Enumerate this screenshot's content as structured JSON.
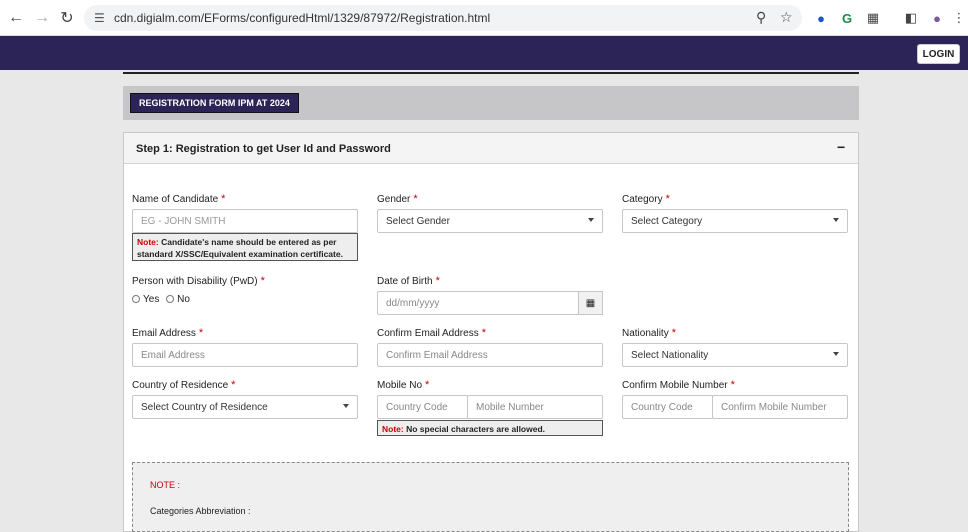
{
  "browser": {
    "url": "cdn.digialm.com/EForms/configuredHtml/1329/87972/Registration.html"
  },
  "header": {
    "login_label": "LOGIN"
  },
  "form": {
    "title": "REGISTRATION FORM IPM AT 2024",
    "step_title": "Step 1: Registration to get User Id and Password",
    "collapse_symbol": "−",
    "required_mark": "*",
    "note_prefix": "Note:",
    "name": {
      "label": "Name of Candidate",
      "placeholder": "EG -  JOHN SMITH",
      "note": "Candidate's name should be entered as per standard X/SSC/Equivalent examination certificate."
    },
    "gender": {
      "label": "Gender",
      "value": "Select Gender"
    },
    "category": {
      "label": "Category",
      "value": "Select Category"
    },
    "pwd": {
      "label": "Person with Disability (PwD)",
      "option_yes": "Yes",
      "option_no": "No"
    },
    "dob": {
      "label": "Date of Birth",
      "placeholder": "dd/mm/yyyy"
    },
    "email": {
      "label": "Email Address",
      "placeholder": "Email Address"
    },
    "confirm_email": {
      "label": "Confirm Email Address",
      "placeholder": "Confirm Email Address"
    },
    "nationality": {
      "label": "Nationality",
      "value": "Select Nationality"
    },
    "country": {
      "label": "Country of Residence",
      "value": "Select Country of Residence"
    },
    "mobile": {
      "label": "Mobile No",
      "code_placeholder": "Country Code",
      "number_placeholder": "Mobile Number",
      "note": "No special characters are allowed."
    },
    "confirm_mobile": {
      "label": "Confirm Mobile Number",
      "code_placeholder": "Country Code",
      "number_placeholder": "Confirm Mobile Number"
    }
  },
  "notes": {
    "title": "NOTE :",
    "abbreviation_label": "Categories Abbreviation :"
  },
  "colors": {
    "header": "#2c2457",
    "required": "#cc0000"
  }
}
